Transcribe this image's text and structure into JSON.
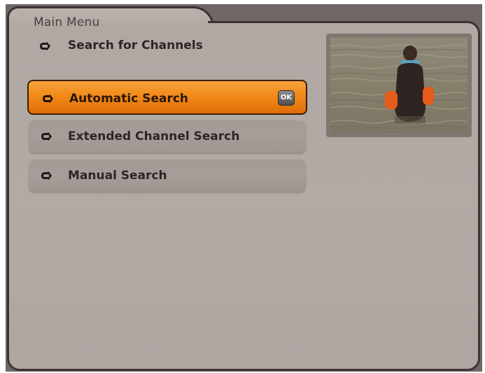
{
  "panel": {
    "title": "Main Menu",
    "section_title": "Search for Channels"
  },
  "menu": {
    "items": [
      {
        "label": "Automatic Search",
        "selected": true
      },
      {
        "label": "Extended Channel Search",
        "selected": false
      },
      {
        "label": "Manual Search",
        "selected": false
      }
    ],
    "ok_badge": "OK"
  },
  "preview": {
    "description_icon": "tv-preview-image"
  },
  "icons": {
    "arrow": "right-arrow-icon"
  },
  "colors": {
    "panel_bg": "#b2aaa5",
    "border": "#3c3434",
    "highlight": "#f08a1a",
    "menu_item": "#a59d98"
  }
}
